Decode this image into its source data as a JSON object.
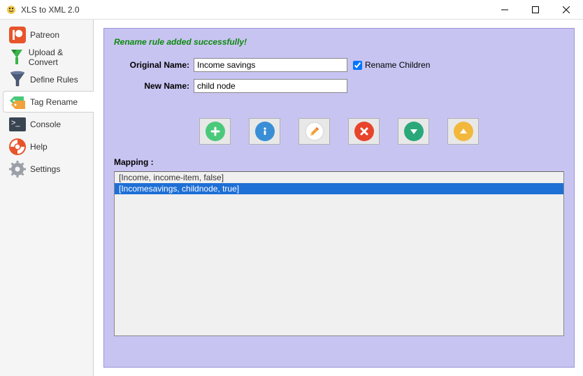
{
  "window": {
    "title": "XLS to XML 2.0"
  },
  "sidebar": {
    "items": [
      {
        "label": "Patreon"
      },
      {
        "label": "Upload & Convert"
      },
      {
        "label": "Define Rules"
      },
      {
        "label": "Tag Rename"
      },
      {
        "label": "Console"
      },
      {
        "label": "Help"
      },
      {
        "label": "Settings"
      }
    ]
  },
  "panel": {
    "status": "Rename rule added successfully!",
    "original_label": "Original Name:",
    "original_value": "Income savings",
    "rename_children_label": "Rename Children",
    "rename_children_checked": true,
    "new_label": "New Name:",
    "new_value": "child node",
    "mapping_label": "Mapping :",
    "mappings": [
      {
        "text": "[Income, income-item, false]",
        "selected": false
      },
      {
        "text": "[Incomesavings, childnode, true]",
        "selected": true
      }
    ]
  }
}
